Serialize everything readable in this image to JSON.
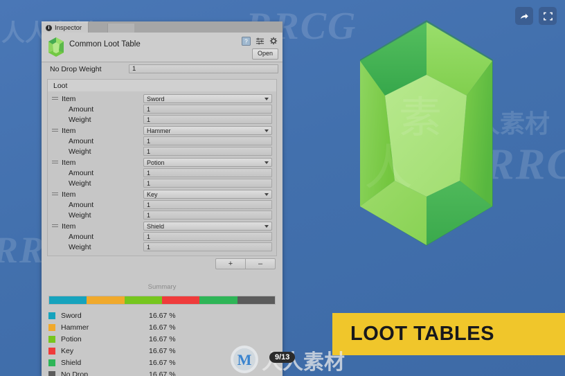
{
  "window": {
    "tab_label": "Inspector",
    "tab_icon": "info-circle-icon",
    "object_title": "Common Loot Table",
    "object_icon": "gem-asset-icon",
    "header_icons": [
      "help-box-icon",
      "preset-sliders-icon",
      "gear-icon"
    ],
    "open_button": "Open"
  },
  "properties": {
    "no_drop_weight_label": "No Drop Weight",
    "no_drop_weight_value": "1",
    "loot_header": "Loot"
  },
  "loot_entries": [
    {
      "item_label": "Item",
      "item_value": "Sword",
      "amount_label": "Amount",
      "amount_value": "1",
      "weight_label": "Weight",
      "weight_value": "1"
    },
    {
      "item_label": "Item",
      "item_value": "Hammer",
      "amount_label": "Amount",
      "amount_value": "1",
      "weight_label": "Weight",
      "weight_value": "1"
    },
    {
      "item_label": "Item",
      "item_value": "Potion",
      "amount_label": "Amount",
      "amount_value": "1",
      "weight_label": "Weight",
      "weight_value": "1"
    },
    {
      "item_label": "Item",
      "item_value": "Key",
      "amount_label": "Amount",
      "amount_value": "1",
      "weight_label": "Weight",
      "weight_value": "1"
    },
    {
      "item_label": "Item",
      "item_value": "Shield",
      "amount_label": "Amount",
      "amount_value": "1",
      "weight_label": "Weight",
      "weight_value": "1"
    }
  ],
  "list_controls": {
    "add": "+",
    "remove": "–"
  },
  "summary": {
    "title": "Summary",
    "legend": [
      {
        "name": "Sword",
        "percent": "16.67 %",
        "color": "#16a3bd"
      },
      {
        "name": "Hammer",
        "percent": "16.67 %",
        "color": "#f0a92c"
      },
      {
        "name": "Potion",
        "percent": "16.67 %",
        "color": "#76c61e"
      },
      {
        "name": "Key",
        "percent": "16.67 %",
        "color": "#ef3b3b"
      },
      {
        "name": "Shield",
        "percent": "16.67 %",
        "color": "#2eb557"
      },
      {
        "name": "No Drop",
        "percent": "16.67 %",
        "color": "#5b5b5b"
      }
    ]
  },
  "chart_data": {
    "type": "bar",
    "title": "Summary",
    "categories": [
      "Sword",
      "Hammer",
      "Potion",
      "Key",
      "Shield",
      "No Drop"
    ],
    "values": [
      16.67,
      16.67,
      16.67,
      16.67,
      16.67,
      16.67
    ],
    "colors": [
      "#16a3bd",
      "#f0a92c",
      "#76c61e",
      "#ef3b3b",
      "#2eb557",
      "#5b5b5b"
    ],
    "unit": "%",
    "xlabel": "",
    "ylabel": "",
    "ylim": [
      0,
      100
    ],
    "legend_position": "below",
    "grid": false,
    "orientation": "horizontal-stacked"
  },
  "banner": {
    "text": "LOOT TABLES",
    "color": "#f0c62b"
  },
  "player": {
    "page_indicator": "9/13",
    "share_icon": "share-arrow-icon",
    "fullscreen_icon": "fullscreen-icon"
  },
  "watermarks": {
    "mark_a": "RRCG",
    "mark_b": "人人素材"
  },
  "theme": {
    "background": "#4572b2",
    "panel": "#c8c8c8",
    "gem_light": "#a8e07a",
    "gem_mid": "#7fd14f",
    "gem_dark": "#3bab4f",
    "gem_darker": "#2f9a48"
  }
}
